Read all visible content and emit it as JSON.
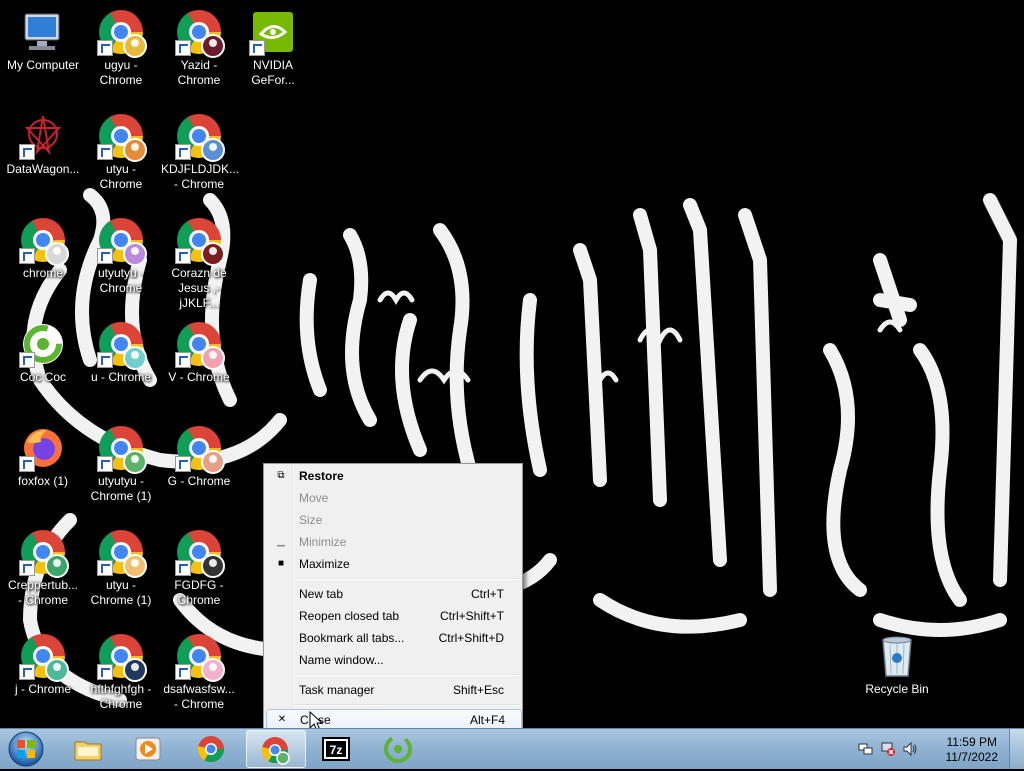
{
  "desktop": {
    "icons": [
      {
        "label": "My Computer",
        "type": "computer"
      },
      {
        "label": "ugyu - Chrome",
        "type": "chrome",
        "avatar": "#e8b93a"
      },
      {
        "label": "Yazid - Chrome",
        "type": "chrome",
        "avatar": "#6a1b2e"
      },
      {
        "label": "NVIDIA GeFor...",
        "type": "nvidia"
      },
      {
        "label": "DataWagon...",
        "type": "datawagon"
      },
      {
        "label": "utyu - Chrome",
        "type": "chrome",
        "avatar": "#e8893a"
      },
      {
        "label": "KDJFLDJDK... - Chrome",
        "type": "chrome",
        "avatar": "#5a8fd6"
      },
      {
        "label": "chrome",
        "type": "chrome",
        "avatar": "#d8d8d8"
      },
      {
        "label": "utyutyu - Chrome",
        "type": "chrome",
        "avatar": "#b98ae0"
      },
      {
        "label": "Corazn de Jesus ,-jJKLF...",
        "type": "chrome",
        "avatar": "#7b1e1e"
      },
      {
        "label": "Coc Coc",
        "type": "coccoc"
      },
      {
        "label": "u - Chrome",
        "type": "chrome",
        "avatar": "#6fcfcf"
      },
      {
        "label": "V - Chrome",
        "type": "chrome",
        "avatar": "#f3a0b0"
      },
      {
        "label": "foxfox (1)",
        "type": "firefox"
      },
      {
        "label": "utyutyu - Chrome (1)",
        "type": "chrome",
        "avatar": "#5db26a"
      },
      {
        "label": "G - Chrome",
        "type": "chrome",
        "avatar": "#e6a088"
      },
      {
        "label": "Creppertub... - Chrome",
        "type": "chrome",
        "avatar": "#3aa66a"
      },
      {
        "label": "utyu - Chrome (1)",
        "type": "chrome",
        "avatar": "#f0c070"
      },
      {
        "label": "FGDFG - Chrome",
        "type": "chrome",
        "avatar": "#333333"
      },
      {
        "label": "j - Chrome",
        "type": "chrome",
        "avatar": "#4db89a"
      },
      {
        "label": "hfthfghfgh - Chrome",
        "type": "chrome",
        "avatar": "#1f3a5e"
      },
      {
        "label": "dsafwasfsw... - Chrome",
        "type": "chrome",
        "avatar": "#f3b0c8"
      },
      {
        "label": "Recycle Bin",
        "type": "recyclebin"
      }
    ]
  },
  "context_menu": {
    "items": [
      {
        "label": "Restore",
        "shortcut": "",
        "glyph": "restore-icon",
        "state": "bold"
      },
      {
        "label": "Move",
        "shortcut": "",
        "glyph": "",
        "state": "disabled"
      },
      {
        "label": "Size",
        "shortcut": "",
        "glyph": "",
        "state": "disabled"
      },
      {
        "label": "Minimize",
        "shortcut": "",
        "glyph": "minimize-icon",
        "state": "disabled"
      },
      {
        "label": "Maximize",
        "shortcut": "",
        "glyph": "maximize-icon",
        "state": "normal"
      },
      {
        "label": "New tab",
        "shortcut": "Ctrl+T",
        "glyph": "",
        "state": "normal"
      },
      {
        "label": "Reopen closed tab",
        "shortcut": "Ctrl+Shift+T",
        "glyph": "",
        "state": "normal"
      },
      {
        "label": "Bookmark all tabs...",
        "shortcut": "Ctrl+Shift+D",
        "glyph": "",
        "state": "normal"
      },
      {
        "label": "Name window...",
        "shortcut": "",
        "glyph": "",
        "state": "normal"
      },
      {
        "label": "Task manager",
        "shortcut": "Shift+Esc",
        "glyph": "",
        "state": "normal"
      },
      {
        "label": "Close",
        "shortcut": "Alt+F4",
        "glyph": "close-icon",
        "state": "hover"
      }
    ]
  },
  "taskbar": {
    "pinned": [
      "windows-explorer",
      "media-player",
      "chrome",
      "chrome-profile",
      "7zip",
      "coccoc"
    ],
    "active": "chrome-profile",
    "clock_time": "11:59 PM",
    "clock_date": "11/7/2022"
  }
}
